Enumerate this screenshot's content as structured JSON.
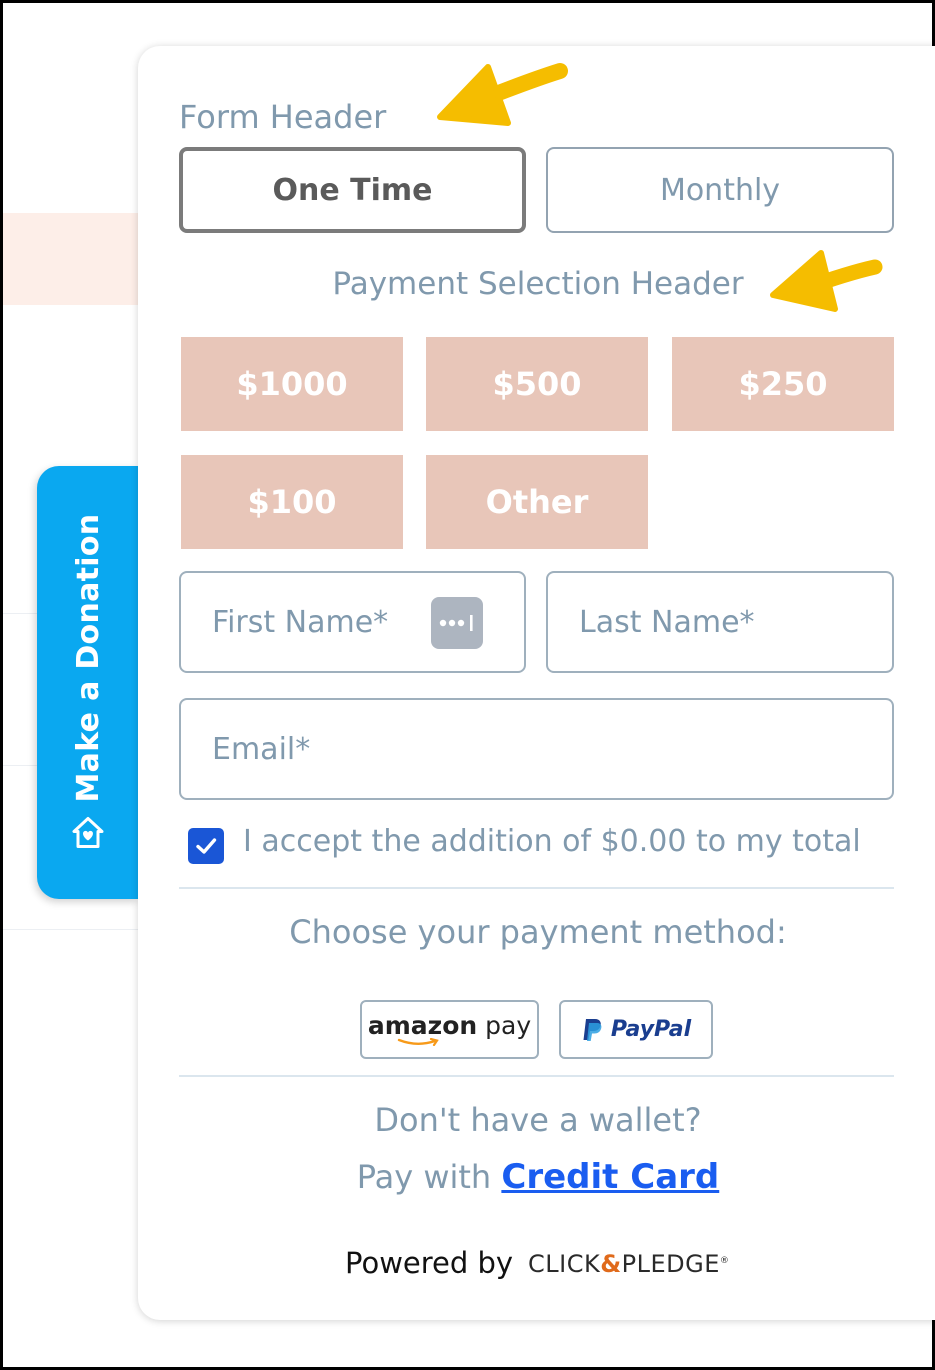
{
  "side_tab": {
    "label": "Make a Donation"
  },
  "form": {
    "header": "Form Header",
    "frequency": {
      "one_time": "One Time",
      "monthly": "Monthly"
    },
    "payment_header": "Payment Selection Header",
    "amounts": [
      "$1000",
      "$500",
      "$250",
      "$100",
      "Other"
    ],
    "fields": {
      "first_name_placeholder": "First Name*",
      "last_name_placeholder": "Last Name*",
      "email_placeholder": "Email*"
    },
    "accept_text": "I accept the addition of $0.00 to my total",
    "choose_payment": "Choose your payment method:",
    "wallets": {
      "amazon_a": "amazon",
      "amazon_b": "pay",
      "paypal": "PayPal"
    },
    "no_wallet": "Don't have a wallet?",
    "pay_with": "Pay with",
    "credit_card": "Credit Card",
    "powered_by": "Powered by",
    "brand_a": "CLICK",
    "brand_amp": "&",
    "brand_b": "PLEDGE"
  },
  "colors": {
    "tab_blue": "#0aa8f0",
    "amount_bg": "#e8c6b9",
    "muted_text": "#8099ad",
    "link_blue": "#1a5df0",
    "arrow_yellow": "#f5bd00"
  },
  "icons": {
    "side_tab": "house-heart-icon",
    "password_manager": "password-dots-icon",
    "checkbox": "check-icon",
    "paypal": "paypal-logo-icon",
    "amazon_smile": "amazon-smile-icon"
  }
}
